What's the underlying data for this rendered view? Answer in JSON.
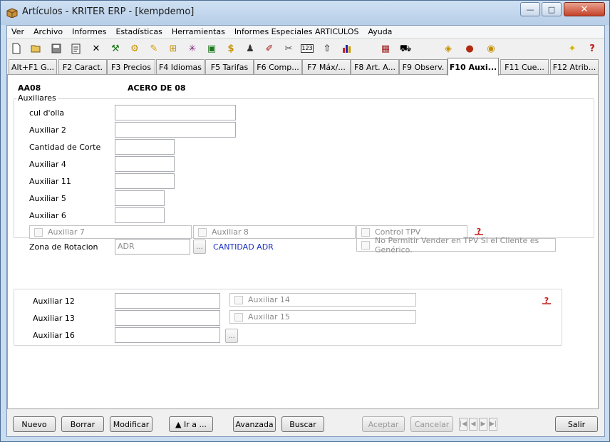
{
  "window": {
    "title": "Artículos - KRITER ERP - [kempdemo]",
    "minimize": "—",
    "maximize": "□",
    "close": "✕"
  },
  "menu": [
    "Ver",
    "Archivo",
    "Informes",
    "Estadísticas",
    "Herramientas",
    "Informes Especiales ARTICULOS",
    "Ayuda"
  ],
  "toolbar_icons": [
    "new-icon",
    "open-icon",
    "save-icon",
    "edit-icon",
    "delete-icon",
    "tools-icon",
    "config-icon",
    "pencil-icon",
    "tree-icon",
    "network-icon",
    "box-icon",
    "money-icon",
    "stamp-icon",
    "paint-icon",
    "tag-icon",
    "numbers-icon",
    "upload-icon",
    "chart-icon",
    "calculator-icon",
    "cart-icon",
    "wallet-icon",
    "moneybag-icon",
    "label-icon",
    "bulb-icon",
    "help-icon"
  ],
  "tabs": [
    "Alt+F1 G...",
    "F2 Caract.",
    "F3 Precios",
    "F4 Idiomas",
    "F5 Tarifas",
    "F6 Comp...",
    "F7 Máx/...",
    "F8 Art. A...",
    "F9 Observ.",
    "F10 Auxi...",
    "F11 Cue...",
    "F12 Atrib..."
  ],
  "active_tab": "F10 Auxi...",
  "article": {
    "code": "AA08",
    "name": "ACERO DE 08"
  },
  "group1": {
    "legend": "Auxiliares",
    "fields": [
      {
        "label": "cul d'olla",
        "value": ""
      },
      {
        "label": "Auxiliar 2",
        "value": ""
      },
      {
        "label": "Cantidad de Corte",
        "value": ""
      },
      {
        "label": "Auxiliar 4",
        "value": ""
      },
      {
        "label": "Auxiliar 11",
        "value": ""
      },
      {
        "label": "Auxiliar 5",
        "value": ""
      },
      {
        "label": "Auxiliar 6",
        "value": ""
      }
    ],
    "checks": [
      "Auxiliar 7",
      "Auxiliar 8",
      "Control TPV",
      "No Permitir Vender en TPV Si el Cliente es Genérico."
    ],
    "zona": {
      "label": "Zona de Rotacion",
      "value": "ADR",
      "button": "...",
      "description": "CANTIDAD ADR"
    }
  },
  "group2": {
    "fields": [
      {
        "label": "Auxiliar 12",
        "value": ""
      },
      {
        "label": "Auxiliar 13",
        "value": ""
      },
      {
        "label": "Auxiliar 16",
        "value": ""
      }
    ],
    "checks": [
      "Auxiliar 14",
      "Auxiliar 15"
    ],
    "button": "..."
  },
  "buttons": {
    "nuevo": "Nuevo",
    "borrar": "Borrar",
    "modificar": "Modificar",
    "ira": "▲ Ir a ...",
    "avanzada": "Avanzada",
    "buscar": "Buscar",
    "aceptar": "Aceptar",
    "cancelar": "Cancelar",
    "salir": "Salir"
  },
  "nav": [
    "|◀",
    "◀",
    "▶",
    "▶|"
  ]
}
